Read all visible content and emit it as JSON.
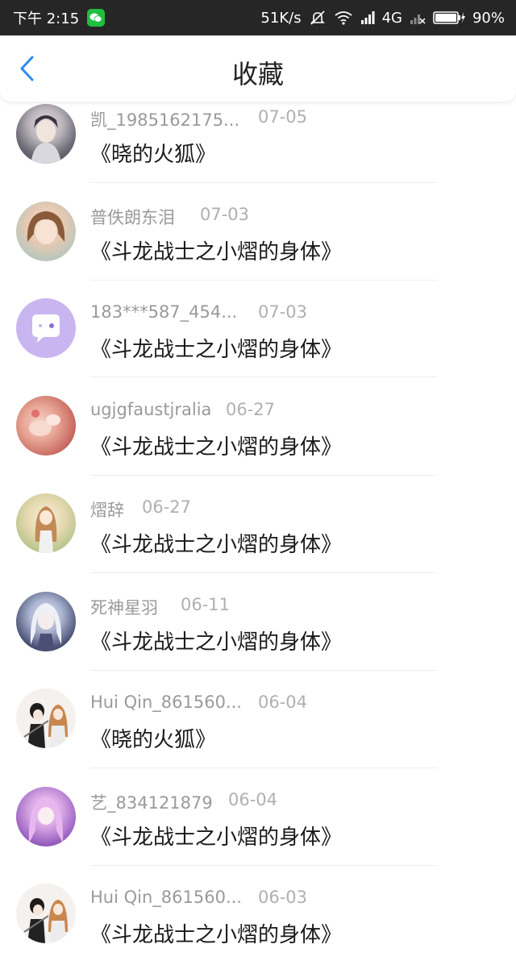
{
  "status_bar": {
    "time": "下午 2:15",
    "network_speed": "51K/s",
    "network_type": "4G",
    "battery": "90%",
    "icons": [
      "wechat-icon",
      "mute-icon",
      "wifi-icon",
      "signal-icon",
      "no-signal-icon",
      "battery-icon"
    ]
  },
  "header": {
    "title": "收藏",
    "back_icon": "chevron-left-icon",
    "accent_color": "#2d8cf0"
  },
  "favorites": [
    {
      "user": "凯_1985162175...",
      "date": "07-05",
      "title": "《晓的火狐》",
      "avatar": "anime-girl-umbrella"
    },
    {
      "user": "普佚朗东泪",
      "date": "07-03",
      "title": "《斗龙战士之小熠的身体》",
      "avatar": "girl-bob-hair"
    },
    {
      "user": "183***587_454...",
      "date": "07-03",
      "title": "《斗龙战士之小熠的身体》",
      "avatar": "default-chat-bubble"
    },
    {
      "user": "ugjgfaustjralia",
      "date": "06-27",
      "title": "《斗龙战士之小熠的身体》",
      "avatar": "hands-flowers"
    },
    {
      "user": "熠辞",
      "date": "06-27",
      "title": "《斗龙战士之小熠的身体》",
      "avatar": "anime-girl-green"
    },
    {
      "user": "死神星羽",
      "date": "06-11",
      "title": "《斗龙战士之小熠的身体》",
      "avatar": "anime-girl-white-hair"
    },
    {
      "user": "Hui Qin_861560...",
      "date": "06-04",
      "title": "《晓的火狐》",
      "avatar": "anime-couple-swords"
    },
    {
      "user": "艺_834121879",
      "date": "06-04",
      "title": "《斗龙战士之小熠的身体》",
      "avatar": "anime-girl-purple"
    },
    {
      "user": "Hui Qin_861560...",
      "date": "06-03",
      "title": "《斗龙战士之小熠的身体》",
      "avatar": "anime-couple-swords"
    }
  ]
}
